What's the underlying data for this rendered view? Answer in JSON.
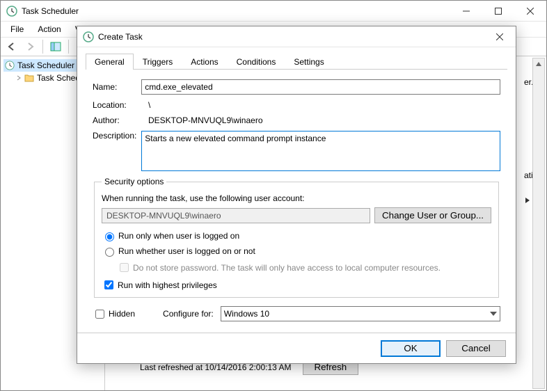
{
  "main_window": {
    "title": "Task Scheduler",
    "menu": {
      "file": "File",
      "action": "Action",
      "view_partial": "Vi"
    },
    "tree": {
      "root": "Task Scheduler",
      "child": "Task Sched"
    },
    "status": "Last refreshed at 10/14/2016 2:00:13 AM",
    "refresh_label": "Refresh",
    "right_truncated_lines": [
      "er...",
      "ati..."
    ]
  },
  "dialog": {
    "title": "Create Task",
    "tabs": {
      "general": "General",
      "triggers": "Triggers",
      "actions": "Actions",
      "conditions": "Conditions",
      "settings": "Settings"
    },
    "labels": {
      "name": "Name:",
      "location": "Location:",
      "author": "Author:",
      "description": "Description:",
      "security_legend": "Security options",
      "when_running": "When running the task, use the following user account:",
      "change_user": "Change User or Group...",
      "run_logged_on": "Run only when user is logged on",
      "run_whether": "Run whether user is logged on or not",
      "do_not_store": "Do not store password.  The task will only have access to local computer resources.",
      "highest_priv": "Run with highest privileges",
      "hidden": "Hidden",
      "configure_for": "Configure for:"
    },
    "values": {
      "name": "cmd.exe_elevated",
      "location": "\\",
      "author": "DESKTOP-MNVUQL9\\winaero",
      "description": "Starts a new elevated command prompt instance",
      "account": "DESKTOP-MNVUQL9\\winaero",
      "configure_for": "Windows 10"
    },
    "buttons": {
      "ok": "OK",
      "cancel": "Cancel"
    }
  }
}
